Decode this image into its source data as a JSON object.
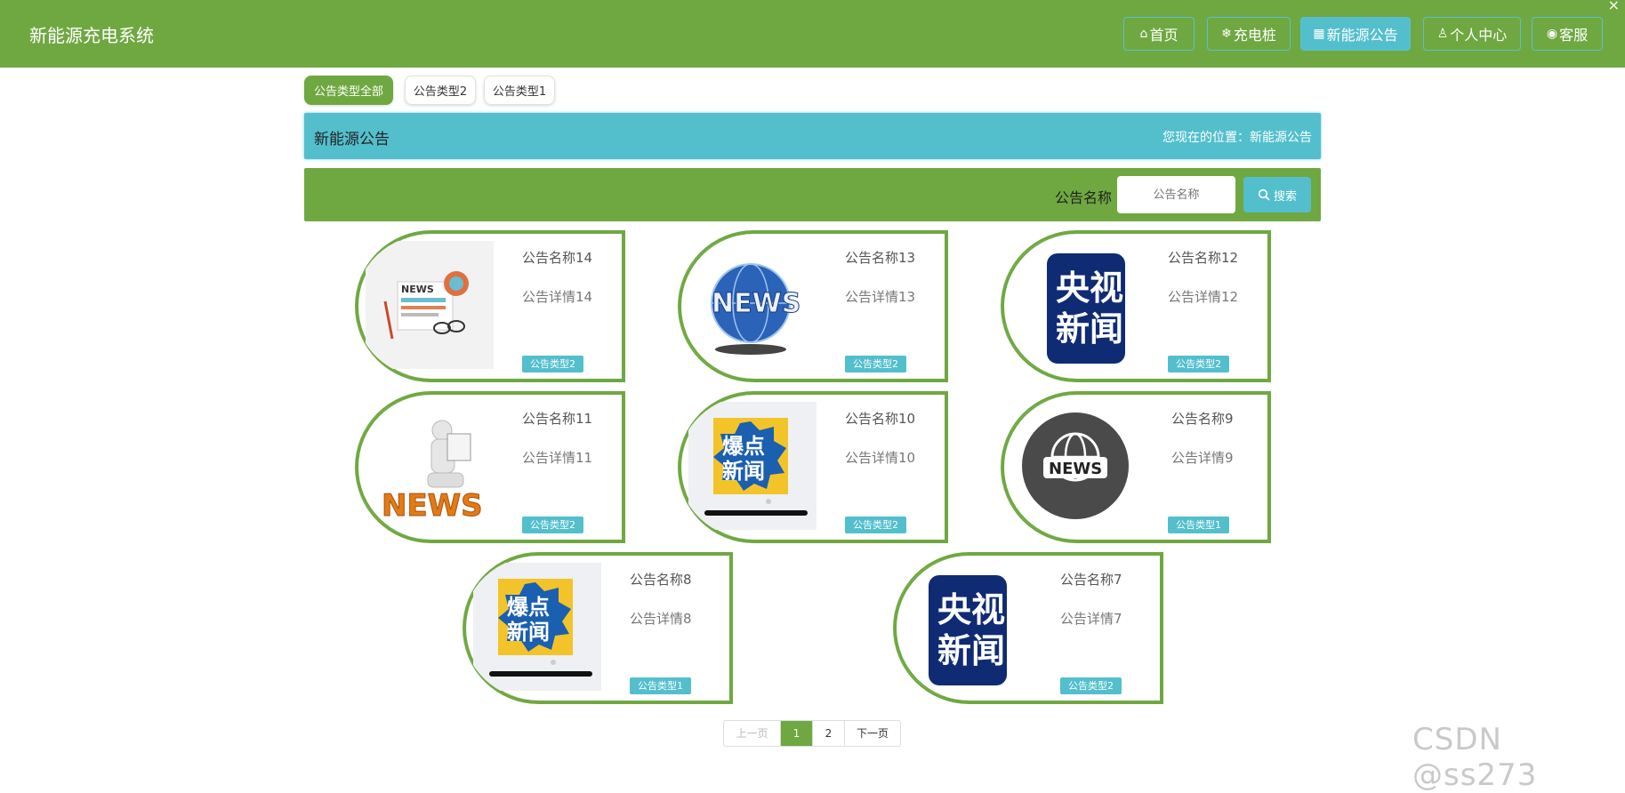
{
  "app": {
    "title": "新能源充电系统"
  },
  "nav": {
    "items": [
      {
        "icon": "home-icon",
        "glyph": "⌂",
        "label": "首页"
      },
      {
        "icon": "snowflake-icon",
        "glyph": "❄",
        "label": "充电桩"
      },
      {
        "icon": "newspaper-icon",
        "glyph": "▦",
        "label": "新能源公告",
        "active": true
      },
      {
        "icon": "user-icon",
        "glyph": "♙",
        "label": "个人中心"
      },
      {
        "icon": "support-icon",
        "glyph": "◉",
        "label": "客服"
      }
    ]
  },
  "filters": {
    "tabs": [
      "公告类型全部",
      "公告类型2",
      "公告类型1"
    ],
    "active_index": 0
  },
  "titlebar": {
    "title": "新能源公告",
    "location": "您现在的位置：新能源公告"
  },
  "search": {
    "label": "公告名称",
    "placeholder": "公告名称",
    "button_label": "搜索"
  },
  "cards": [
    {
      "name": "公告名称14",
      "detail": "公告详情14",
      "type": "公告类型2",
      "image": "news-desk"
    },
    {
      "name": "公告名称13",
      "detail": "公告详情13",
      "type": "公告类型2",
      "image": "news-globe"
    },
    {
      "name": "公告名称12",
      "detail": "公告详情12",
      "type": "公告类型2",
      "image": "cctv-news"
    },
    {
      "name": "公告名称11",
      "detail": "公告详情11",
      "type": "公告类型2",
      "image": "news-reader"
    },
    {
      "name": "公告名称10",
      "detail": "公告详情10",
      "type": "公告类型2",
      "image": "baodian-news"
    },
    {
      "name": "公告名称9",
      "detail": "公告详情9",
      "type": "公告类型1",
      "image": "news-globe-circle"
    },
    {
      "name": "公告名称8",
      "detail": "公告详情8",
      "type": "公告类型1",
      "image": "baodian-news"
    },
    {
      "name": "公告名称7",
      "detail": "公告详情7",
      "type": "公告类型2",
      "image": "cctv-news"
    }
  ],
  "image_text": {
    "cctv_line1": "央视",
    "cctv_line2": "新闻",
    "baodian_line1": "爆点",
    "baodian_line2": "新闻",
    "news": "NEWS"
  },
  "pagination": {
    "prev": "上一页",
    "pages": [
      "1",
      "2"
    ],
    "current": "1",
    "next": "下一页"
  },
  "watermark": "CSDN @ss273",
  "colors": {
    "green": "#6fa841",
    "teal": "#53bfcd"
  }
}
